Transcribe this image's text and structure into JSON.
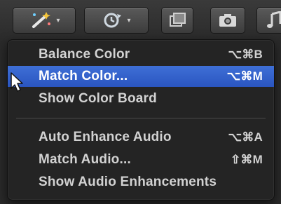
{
  "toolbar": {
    "buttons": [
      {
        "icon": "magic-wand-icon",
        "has_dropdown": true
      },
      {
        "icon": "retime-icon",
        "has_dropdown": true
      },
      {
        "icon": "transform-icon",
        "has_dropdown": false
      },
      {
        "icon": "camera-icon",
        "has_dropdown": false
      },
      {
        "icon": "music-note-icon",
        "has_dropdown": false
      }
    ],
    "caret": "▾"
  },
  "menu": {
    "items": [
      {
        "label": "Balance Color",
        "shortcut": "⌥⌘B",
        "highlighted": false
      },
      {
        "label": "Match Color...",
        "shortcut": "⌥⌘M",
        "highlighted": true
      },
      {
        "label": "Show Color Board",
        "shortcut": "",
        "highlighted": false
      },
      {
        "label": "Auto Enhance Audio",
        "shortcut": "⌥⌘A",
        "highlighted": false
      },
      {
        "label": "Match Audio...",
        "shortcut": "⇧⌘M",
        "highlighted": false
      },
      {
        "label": "Show Audio Enhancements",
        "shortcut": "",
        "highlighted": false
      }
    ]
  },
  "colors": {
    "highlight": "#2f5fcf",
    "menu_bg": "#242424",
    "text": "#d2d2d2"
  }
}
